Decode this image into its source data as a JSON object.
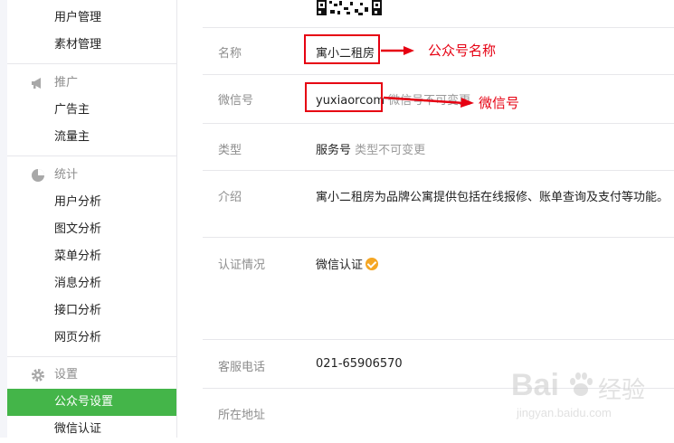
{
  "sidebar": {
    "items_top": [
      "用户管理",
      "素材管理"
    ],
    "section_promo": {
      "label": "推广",
      "icon": "megaphone-icon",
      "items": [
        "广告主",
        "流量主"
      ]
    },
    "section_stats": {
      "label": "统计",
      "icon": "pie-chart-icon",
      "items": [
        "用户分析",
        "图文分析",
        "菜单分析",
        "消息分析",
        "接口分析",
        "网页分析"
      ]
    },
    "section_settings": {
      "label": "设置",
      "icon": "gear-icon",
      "items": [
        "公众号设置",
        "微信认证"
      ]
    },
    "active_item": "公众号设置"
  },
  "account": {
    "name_label": "名称",
    "name_value": "寓小二租房",
    "wechat_id_label": "微信号",
    "wechat_id_value": "yuxiaorcom",
    "wechat_id_note": "微信号不可变更",
    "type_label": "类型",
    "type_value": "服务号",
    "type_note": "类型不可变更",
    "intro_label": "介绍",
    "intro_value": "寓小二租房为品牌公寓提供包括在线报修、账单查询及支付等功能。",
    "verify_label": "认证情况",
    "verify_value": "微信认证",
    "phone_label": "客服电话",
    "phone_value": "021-65906570",
    "address_label": "所在地址"
  },
  "annotations": {
    "name_note": "公众号名称",
    "wechat_id_note": "微信号",
    "highlight_color": "#e60012"
  },
  "watermark": {
    "brand": "Bai",
    "brand2": "经验",
    "url": "jingyan.baidu.com"
  },
  "colors": {
    "active_bg": "#44b549",
    "verified_badge": "#f5a623"
  }
}
